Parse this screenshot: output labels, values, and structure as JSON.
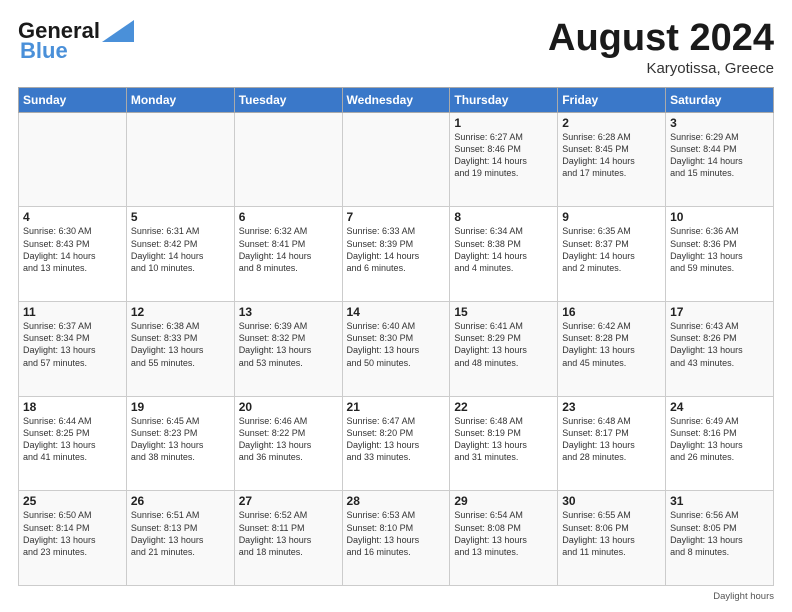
{
  "header": {
    "logo_line1": "General",
    "logo_line2": "Blue",
    "main_title": "August 2024",
    "subtitle": "Karyotissa, Greece"
  },
  "days_of_week": [
    "Sunday",
    "Monday",
    "Tuesday",
    "Wednesday",
    "Thursday",
    "Friday",
    "Saturday"
  ],
  "weeks": [
    [
      {
        "day": "",
        "detail": ""
      },
      {
        "day": "",
        "detail": ""
      },
      {
        "day": "",
        "detail": ""
      },
      {
        "day": "",
        "detail": ""
      },
      {
        "day": "1",
        "detail": "Sunrise: 6:27 AM\nSunset: 8:46 PM\nDaylight: 14 hours\nand 19 minutes."
      },
      {
        "day": "2",
        "detail": "Sunrise: 6:28 AM\nSunset: 8:45 PM\nDaylight: 14 hours\nand 17 minutes."
      },
      {
        "day": "3",
        "detail": "Sunrise: 6:29 AM\nSunset: 8:44 PM\nDaylight: 14 hours\nand 15 minutes."
      }
    ],
    [
      {
        "day": "4",
        "detail": "Sunrise: 6:30 AM\nSunset: 8:43 PM\nDaylight: 14 hours\nand 13 minutes."
      },
      {
        "day": "5",
        "detail": "Sunrise: 6:31 AM\nSunset: 8:42 PM\nDaylight: 14 hours\nand 10 minutes."
      },
      {
        "day": "6",
        "detail": "Sunrise: 6:32 AM\nSunset: 8:41 PM\nDaylight: 14 hours\nand 8 minutes."
      },
      {
        "day": "7",
        "detail": "Sunrise: 6:33 AM\nSunset: 8:39 PM\nDaylight: 14 hours\nand 6 minutes."
      },
      {
        "day": "8",
        "detail": "Sunrise: 6:34 AM\nSunset: 8:38 PM\nDaylight: 14 hours\nand 4 minutes."
      },
      {
        "day": "9",
        "detail": "Sunrise: 6:35 AM\nSunset: 8:37 PM\nDaylight: 14 hours\nand 2 minutes."
      },
      {
        "day": "10",
        "detail": "Sunrise: 6:36 AM\nSunset: 8:36 PM\nDaylight: 13 hours\nand 59 minutes."
      }
    ],
    [
      {
        "day": "11",
        "detail": "Sunrise: 6:37 AM\nSunset: 8:34 PM\nDaylight: 13 hours\nand 57 minutes."
      },
      {
        "day": "12",
        "detail": "Sunrise: 6:38 AM\nSunset: 8:33 PM\nDaylight: 13 hours\nand 55 minutes."
      },
      {
        "day": "13",
        "detail": "Sunrise: 6:39 AM\nSunset: 8:32 PM\nDaylight: 13 hours\nand 53 minutes."
      },
      {
        "day": "14",
        "detail": "Sunrise: 6:40 AM\nSunset: 8:30 PM\nDaylight: 13 hours\nand 50 minutes."
      },
      {
        "day": "15",
        "detail": "Sunrise: 6:41 AM\nSunset: 8:29 PM\nDaylight: 13 hours\nand 48 minutes."
      },
      {
        "day": "16",
        "detail": "Sunrise: 6:42 AM\nSunset: 8:28 PM\nDaylight: 13 hours\nand 45 minutes."
      },
      {
        "day": "17",
        "detail": "Sunrise: 6:43 AM\nSunset: 8:26 PM\nDaylight: 13 hours\nand 43 minutes."
      }
    ],
    [
      {
        "day": "18",
        "detail": "Sunrise: 6:44 AM\nSunset: 8:25 PM\nDaylight: 13 hours\nand 41 minutes."
      },
      {
        "day": "19",
        "detail": "Sunrise: 6:45 AM\nSunset: 8:23 PM\nDaylight: 13 hours\nand 38 minutes."
      },
      {
        "day": "20",
        "detail": "Sunrise: 6:46 AM\nSunset: 8:22 PM\nDaylight: 13 hours\nand 36 minutes."
      },
      {
        "day": "21",
        "detail": "Sunrise: 6:47 AM\nSunset: 8:20 PM\nDaylight: 13 hours\nand 33 minutes."
      },
      {
        "day": "22",
        "detail": "Sunrise: 6:48 AM\nSunset: 8:19 PM\nDaylight: 13 hours\nand 31 minutes."
      },
      {
        "day": "23",
        "detail": "Sunrise: 6:48 AM\nSunset: 8:17 PM\nDaylight: 13 hours\nand 28 minutes."
      },
      {
        "day": "24",
        "detail": "Sunrise: 6:49 AM\nSunset: 8:16 PM\nDaylight: 13 hours\nand 26 minutes."
      }
    ],
    [
      {
        "day": "25",
        "detail": "Sunrise: 6:50 AM\nSunset: 8:14 PM\nDaylight: 13 hours\nand 23 minutes."
      },
      {
        "day": "26",
        "detail": "Sunrise: 6:51 AM\nSunset: 8:13 PM\nDaylight: 13 hours\nand 21 minutes."
      },
      {
        "day": "27",
        "detail": "Sunrise: 6:52 AM\nSunset: 8:11 PM\nDaylight: 13 hours\nand 18 minutes."
      },
      {
        "day": "28",
        "detail": "Sunrise: 6:53 AM\nSunset: 8:10 PM\nDaylight: 13 hours\nand 16 minutes."
      },
      {
        "day": "29",
        "detail": "Sunrise: 6:54 AM\nSunset: 8:08 PM\nDaylight: 13 hours\nand 13 minutes."
      },
      {
        "day": "30",
        "detail": "Sunrise: 6:55 AM\nSunset: 8:06 PM\nDaylight: 13 hours\nand 11 minutes."
      },
      {
        "day": "31",
        "detail": "Sunrise: 6:56 AM\nSunset: 8:05 PM\nDaylight: 13 hours\nand 8 minutes."
      }
    ]
  ],
  "footer": {
    "daylight_label": "Daylight hours"
  }
}
